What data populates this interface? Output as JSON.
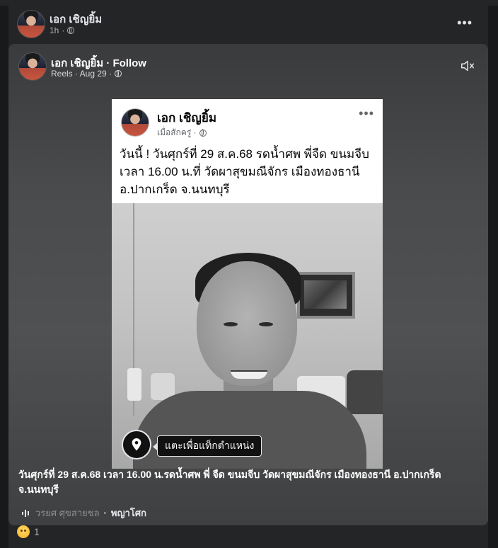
{
  "post": {
    "author": "เอก เชิญยิ้ม",
    "time": "1h",
    "more": "•••"
  },
  "reel": {
    "author_line": "เอก เชิญยิ้ม · Follow",
    "meta_label": "Reels · Aug 29 ·",
    "mute_icon": "speaker-muted-icon"
  },
  "card": {
    "author": "เอก เชิญยิ้ม",
    "meta": "เมื่อสักครู่ ·",
    "more": "•••",
    "text": "วันนี้ ! วันศุกร์ที่ 29 ส.ค.68 รดน้ำศพ พี่จืด ขนมจีบ เวลา 16.00 น.ที่ วัดผาสุขมณีจักร เมืองทองธานี อ.ปากเกร็ด จ.นนทบุรี"
  },
  "tag": {
    "label": "แตะเพื่อแท็กตำแหน่ง",
    "icon": "location-pin-icon"
  },
  "caption": "วันศุกร์ที่ 29 ส.ค.68 เวลา 16.00 น.รดน้ำศพ พี่ จืด ขนมจีบ วัดผาสุขมณีจักร เมืองทองธานี อ.ปากเกร็ด จ.นนทบุรี",
  "audio": {
    "artist": "วรยศ ศุขสายชล",
    "separator": " · ",
    "title": "พญาโศก"
  },
  "reactions": {
    "emoji": "sad-emoji",
    "count": "1"
  }
}
